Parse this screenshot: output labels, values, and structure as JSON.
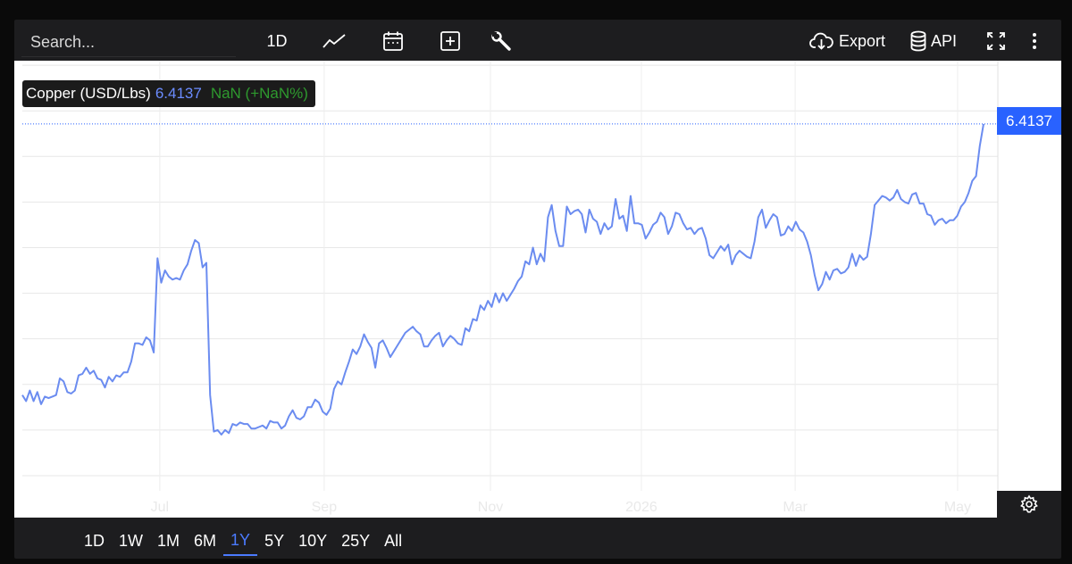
{
  "toolbar": {
    "search_placeholder": "Search...",
    "interval_label": "1D",
    "export_label": "Export",
    "api_label": "API",
    "icons": [
      "line-chart-icon",
      "calendar-icon",
      "plus-box-icon",
      "wrench-icon",
      "cloud-download-icon",
      "database-icon",
      "fullscreen-icon",
      "more-vertical-icon"
    ]
  },
  "legend": {
    "name": "Copper (USD/Lbs)",
    "value": "6.4137",
    "change": "NaN (+NaN%)"
  },
  "price_tag": "6.4137",
  "ranges": {
    "items": [
      "1D",
      "1W",
      "1M",
      "6M",
      "1Y",
      "5Y",
      "10Y",
      "25Y",
      "All"
    ],
    "active": "1Y"
  },
  "colors": {
    "line": "#6b8cf0",
    "price_tag": "#2962ff",
    "active_range": "#4b7bff",
    "change": "#2e9a2e"
  },
  "chart_data": {
    "type": "line",
    "title": "Copper (USD/Lbs)",
    "xlabel": "",
    "ylabel": "",
    "x_tick_labels": [
      "Jul",
      "Sep",
      "Nov",
      "2026",
      "Mar",
      "May"
    ],
    "last_value": 6.4137,
    "y_tick_labels_visible": false,
    "grid": true,
    "series": [
      {
        "name": "Copper (USD/Lbs)",
        "values": [
          4.63,
          4.59,
          4.66,
          4.59,
          4.65,
          4.57,
          4.62,
          4.61,
          4.62,
          4.63,
          4.74,
          4.72,
          4.65,
          4.64,
          4.66,
          4.76,
          4.77,
          4.81,
          4.77,
          4.79,
          4.74,
          4.73,
          4.68,
          4.75,
          4.72,
          4.76,
          4.75,
          4.78,
          4.78,
          4.85,
          4.97,
          4.97,
          4.96,
          5.01,
          4.99,
          4.91,
          5.53,
          5.37,
          5.45,
          5.41,
          5.39,
          5.4,
          5.39,
          5.45,
          5.49,
          5.58,
          5.65,
          5.63,
          5.47,
          5.5,
          4.63,
          4.39,
          4.4,
          4.37,
          4.4,
          4.38,
          4.44,
          4.43,
          4.45,
          4.44,
          4.44,
          4.41,
          4.41,
          4.42,
          4.43,
          4.41,
          4.46,
          4.45,
          4.45,
          4.41,
          4.43,
          4.49,
          4.53,
          4.48,
          4.47,
          4.49,
          4.55,
          4.55,
          4.6,
          4.58,
          4.52,
          4.5,
          4.54,
          4.67,
          4.72,
          4.7,
          4.78,
          4.85,
          4.93,
          4.9,
          4.95,
          5.03,
          4.98,
          4.94,
          4.81,
          4.97,
          4.99,
          4.94,
          4.88,
          4.92,
          4.96,
          5.0,
          5.04,
          5.06,
          5.08,
          5.05,
          5.03,
          4.95,
          4.95,
          4.99,
          5.02,
          5.04,
          4.95,
          4.99,
          5.02,
          5.0,
          4.97,
          4.96,
          5.07,
          5.05,
          5.13,
          5.12,
          5.22,
          5.19,
          5.25,
          5.21,
          5.3,
          5.24,
          5.3,
          5.25,
          5.29,
          5.33,
          5.38,
          5.41,
          5.51,
          5.49,
          5.6,
          5.49,
          5.56,
          5.51,
          5.8,
          5.88,
          5.71,
          5.61,
          5.61,
          5.87,
          5.82,
          5.84,
          5.85,
          5.82,
          5.7,
          5.85,
          5.79,
          5.77,
          5.69,
          5.76,
          5.72,
          5.74,
          5.92,
          5.79,
          5.81,
          5.71,
          5.94,
          5.76,
          5.76,
          5.75,
          5.66,
          5.7,
          5.75,
          5.77,
          5.83,
          5.8,
          5.69,
          5.74,
          5.83,
          5.82,
          5.76,
          5.72,
          5.73,
          5.69,
          5.72,
          5.73,
          5.66,
          5.55,
          5.53,
          5.57,
          5.61,
          5.58,
          5.62,
          5.49,
          5.55,
          5.58,
          5.56,
          5.54,
          5.53,
          5.64,
          5.8,
          5.85,
          5.73,
          5.78,
          5.82,
          5.8,
          5.68,
          5.69,
          5.74,
          5.71,
          5.77,
          5.72,
          5.7,
          5.64,
          5.55,
          5.42,
          5.32,
          5.36,
          5.44,
          5.39,
          5.45,
          5.46,
          5.43,
          5.44,
          5.47,
          5.56,
          5.48,
          5.55,
          5.52,
          5.54,
          5.69,
          5.88,
          5.91,
          5.94,
          5.93,
          5.91,
          5.93,
          5.98,
          5.92,
          5.9,
          5.89,
          5.95,
          5.96,
          5.89,
          5.89,
          5.82,
          5.81,
          5.75,
          5.78,
          5.79,
          5.76,
          5.78,
          5.78,
          5.81,
          5.87,
          5.9,
          5.96,
          6.04,
          6.07,
          6.27,
          6.4137
        ]
      }
    ]
  }
}
